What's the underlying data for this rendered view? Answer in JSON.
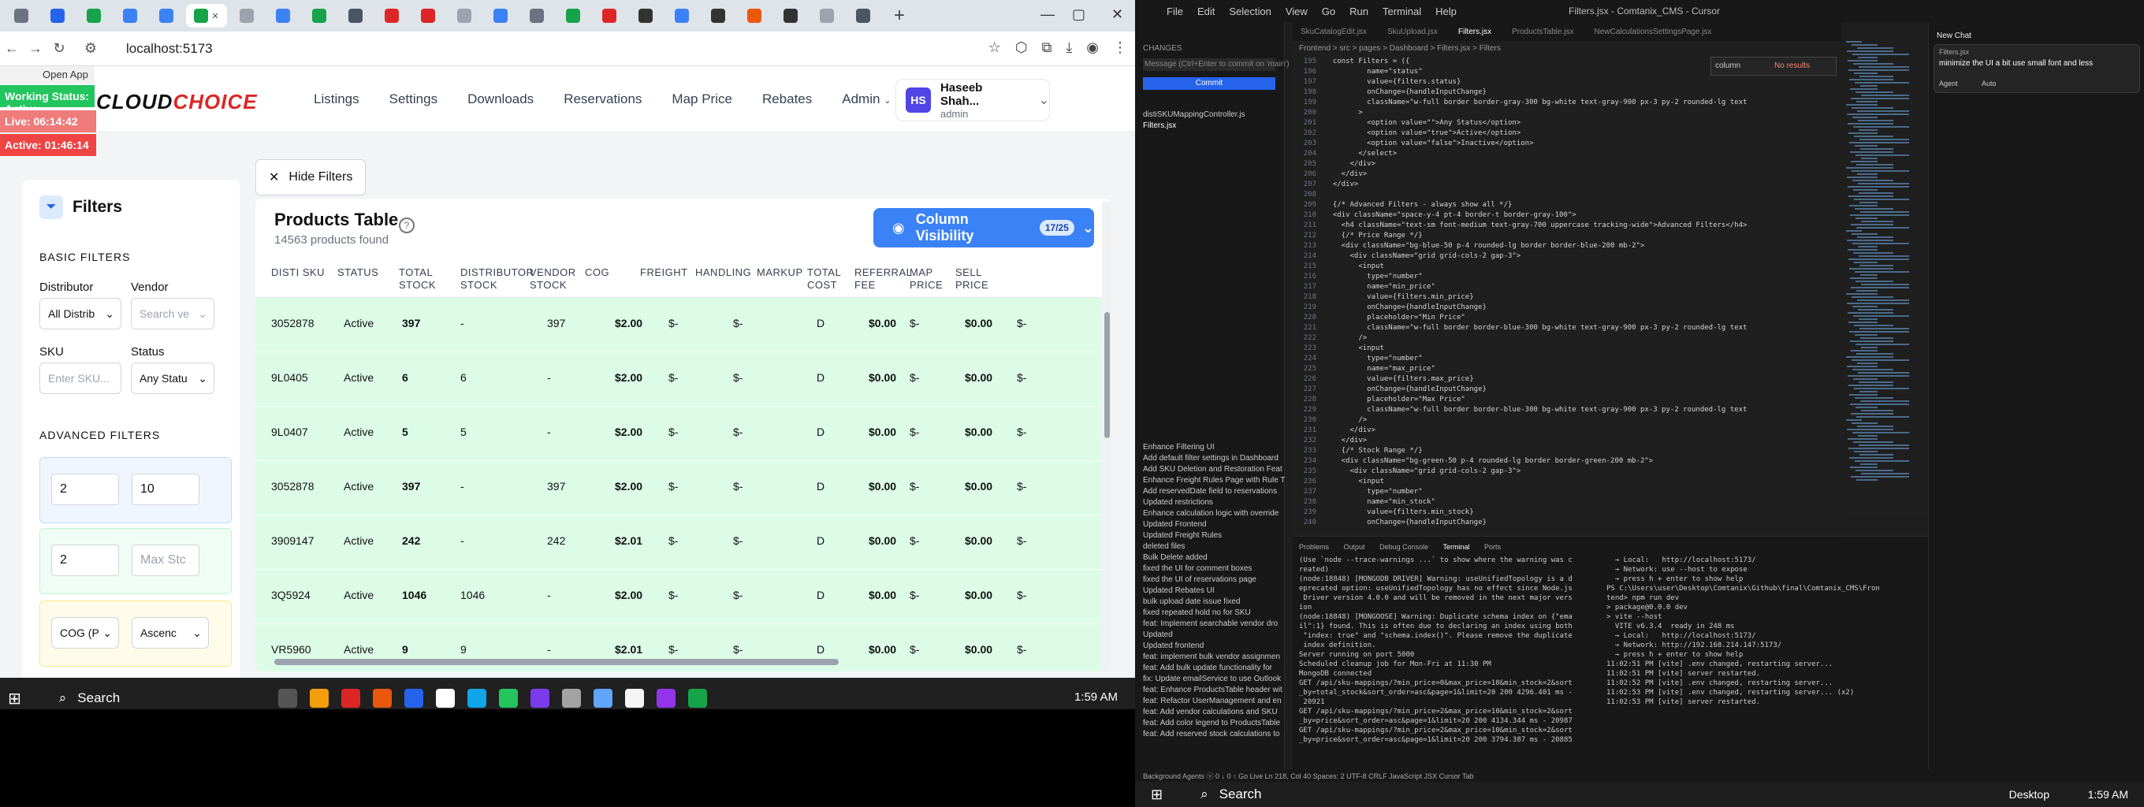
{
  "browser": {
    "url": "localhost:5173",
    "favicons": [
      "#6b7280",
      "#2563eb",
      "#16a34a",
      "#3b82f6",
      "#3b82f6",
      "#16a34a",
      "#9ca3af",
      "#3b82f6",
      "#16a34a",
      "#4b5563",
      "#dc2626",
      "#dc2626",
      "#9ca3af",
      "#3b82f6",
      "#6b7280",
      "#16a34a",
      "#dc2626",
      "#333333",
      "#3b82f6",
      "#333333",
      "#ea580c",
      "#333333",
      "#9ca3af",
      "#4b5563"
    ]
  },
  "overlay": {
    "open_app": "Open App",
    "working_status": "Working Status: Active",
    "live": "Live: 06:14:42",
    "active": "Active: 01:46:14"
  },
  "app": {
    "logo_main": "CLOUD",
    "logo_accent": "CHOICE",
    "nav": [
      "Listings",
      "Settings",
      "Downloads",
      "Reservations",
      "Map Price",
      "Rebates",
      "Admin"
    ],
    "user_name": "Haseeb Shah...",
    "user_role": "admin",
    "user_initials": "HS",
    "hide_filters": "Hide Filters"
  },
  "filters": {
    "title": "Filters",
    "basic": "BASIC FILTERS",
    "distributor_label": "Distributor",
    "distributor_value": "All Distrib",
    "vendor_label": "Vendor",
    "vendor_placeholder": "Search ve",
    "sku_label": "SKU",
    "sku_placeholder": "Enter SKU...",
    "status_label": "Status",
    "status_value": "Any Statu",
    "advanced": "ADVANCED FILTERS",
    "price_min": "2",
    "price_max": "10",
    "stock_min": "2",
    "stock_max_placeholder": "Max Stc",
    "sort_field": "COG (P",
    "sort_order": "Ascenc"
  },
  "products": {
    "title": "Products Table",
    "subtitle": "14563 products found",
    "col_visibility": "Column Visibility",
    "col_count": "17/25",
    "columns": [
      "DISTI SKU",
      "STATUS",
      "TOTAL STOCK",
      "DISTRIBUTOR STOCK",
      "VENDOR STOCK",
      "COG",
      "FREIGHT",
      "HANDLING",
      "MARKUP",
      "TOTAL COST",
      "REFERRAL FEE",
      "MAP PRICE",
      "SELL PRICE"
    ],
    "rows": [
      [
        "3052878",
        "Active",
        "397",
        "-",
        "397",
        "$2.00",
        "$-",
        "$-",
        "D",
        "$0.00",
        "$-",
        "$-",
        "$0.00",
        "$-"
      ],
      [
        "9L0405",
        "Active",
        "6",
        "6",
        "-",
        "$2.00",
        "$-",
        "$-",
        "D",
        "$0.00",
        "$-",
        "$-",
        "$0.00",
        "$-"
      ],
      [
        "9L0407",
        "Active",
        "5",
        "5",
        "-",
        "$2.00",
        "$-",
        "$-",
        "D",
        "$0.00",
        "$-",
        "$-",
        "$0.00",
        "$-"
      ],
      [
        "3052878",
        "Active",
        "397",
        "-",
        "397",
        "$2.00",
        "$-",
        "$-",
        "D",
        "$0.00",
        "$-",
        "$-",
        "$0.00",
        "$-"
      ],
      [
        "3909147",
        "Active",
        "242",
        "-",
        "242",
        "$2.01",
        "$-",
        "$-",
        "D",
        "$0.00",
        "$-",
        "$-",
        "$0.00",
        "$-"
      ],
      [
        "3Q5924",
        "Active",
        "1046",
        "1046",
        "-",
        "$2.00",
        "$-",
        "$-",
        "D",
        "$0.00",
        "$-",
        "$-",
        "$0.00",
        "$-"
      ],
      [
        "VR5960",
        "Active",
        "9",
        "9",
        "-",
        "$2.01",
        "$-",
        "$-",
        "D",
        "$0.00",
        "$-",
        "$-",
        "$0.00",
        "$-"
      ]
    ]
  },
  "taskbar": {
    "search": "Search",
    "time_left": "1:59 AM",
    "time_right": "1:59 AM",
    "desktop": "Desktop"
  },
  "editor": {
    "menu": [
      "File",
      "Edit",
      "Selection",
      "View",
      "Go",
      "Run",
      "Terminal",
      "Help"
    ],
    "window_title": "Filters.jsx - Comtanix_CMS - Cursor",
    "tabs": [
      "SkuCatalogEdit.jsx",
      "SkuUpload.jsx",
      "Filters.jsx",
      "ProductsTable.jsx",
      "NewCalculationsSettingsPage.jsx"
    ],
    "breadcrumb": "Frontend > src > pages > Dashboard > Filters.jsx > Filters",
    "find_value": "column",
    "find_result": "No results",
    "code": [
      {
        "n": "195",
        "t": "  const Filters = ({"
      },
      {
        "n": "196",
        "t": "          name=\"status\""
      },
      {
        "n": "197",
        "t": "          value={filters.status}"
      },
      {
        "n": "198",
        "t": "          onChange={handleInputChange}"
      },
      {
        "n": "199",
        "t": "          className=\"w-full border border-gray-300 bg-white text-gray-900 px-3 py-2 rounded-lg text"
      },
      {
        "n": "200",
        "t": "        >"
      },
      {
        "n": "201",
        "t": "          <option value=\"\">Any Status</option>"
      },
      {
        "n": "202",
        "t": "          <option value=\"true\">Active</option>"
      },
      {
        "n": "203",
        "t": "          <option value=\"false\">Inactive</option>"
      },
      {
        "n": "204",
        "t": "        </select>"
      },
      {
        "n": "205",
        "t": "      </div>"
      },
      {
        "n": "206",
        "t": "    </div>"
      },
      {
        "n": "207",
        "t": "  </div>"
      },
      {
        "n": "208",
        "t": ""
      },
      {
        "n": "209",
        "t": "  {/* Advanced Filters - always show all */}"
      },
      {
        "n": "210",
        "t": "  <div className=\"space-y-4 pt-4 border-t border-gray-100\">"
      },
      {
        "n": "211",
        "t": "    <h4 className=\"text-sm font-medium text-gray-700 uppercase tracking-wide\">Advanced Filters</h4>"
      },
      {
        "n": "212",
        "t": "    {/* Price Range */}"
      },
      {
        "n": "213",
        "t": "    <div className=\"bg-blue-50 p-4 rounded-lg border border-blue-200 mb-2\">"
      },
      {
        "n": "214",
        "t": "      <div className=\"grid grid-cols-2 gap-3\">"
      },
      {
        "n": "215",
        "t": "        <input"
      },
      {
        "n": "216",
        "t": "          type=\"number\""
      },
      {
        "n": "217",
        "t": "          name=\"min_price\""
      },
      {
        "n": "218",
        "t": "          value={filters.min_price}"
      },
      {
        "n": "219",
        "t": "          onChange={handleInputChange}"
      },
      {
        "n": "220",
        "t": "          placeholder=\"Min Price\""
      },
      {
        "n": "221",
        "t": "          className=\"w-full border border-blue-300 bg-white text-gray-900 px-3 py-2 rounded-lg text"
      },
      {
        "n": "222",
        "t": "        />"
      },
      {
        "n": "223",
        "t": "        <input"
      },
      {
        "n": "224",
        "t": "          type=\"number\""
      },
      {
        "n": "225",
        "t": "          name=\"max_price\""
      },
      {
        "n": "226",
        "t": "          value={filters.max_price}"
      },
      {
        "n": "227",
        "t": "          onChange={handleInputChange}"
      },
      {
        "n": "228",
        "t": "          placeholder=\"Max Price\""
      },
      {
        "n": "229",
        "t": "          className=\"w-full border border-blue-300 bg-white text-gray-900 px-3 py-2 rounded-lg text"
      },
      {
        "n": "230",
        "t": "        />"
      },
      {
        "n": "231",
        "t": "      </div>"
      },
      {
        "n": "232",
        "t": "    </div>"
      },
      {
        "n": "233",
        "t": "    {/* Stock Range */}"
      },
      {
        "n": "234",
        "t": "    <div className=\"bg-green-50 p-4 rounded-lg border border-green-200 mb-2\">"
      },
      {
        "n": "235",
        "t": "      <div className=\"grid grid-cols-2 gap-3\">"
      },
      {
        "n": "236",
        "t": "        <input"
      },
      {
        "n": "237",
        "t": "          type=\"number\""
      },
      {
        "n": "238",
        "t": "          name=\"min_stock\""
      },
      {
        "n": "239",
        "t": "          value={filters.min_stock}"
      },
      {
        "n": "240",
        "t": "          onChange={handleInputChange}"
      }
    ],
    "chat_title": "New Chat",
    "chat_file": "Filters.jsx",
    "chat_text": "minimize the UI a bit use small font and less",
    "chat_mode": "Agent",
    "chat_model": "Auto",
    "scm_header": "CHANGES",
    "scm_message": "Message (Ctrl+Enter to commit on 'main')",
    "scm_commit": "Commit",
    "scm_files": [
      "distiSKUMappingController.js",
      "Filters.jsx"
    ],
    "graph_items": [
      "Enhance Filtering UI",
      "Add default filter settings in Dashboard",
      "Add SKU Deletion and Restoration Feat",
      "Enhance Freight Rules Page with Rule T",
      "Add reservedDate field to reservations",
      "Updated restrictions",
      "Enhance calculation logic with override",
      "Updated Frontend",
      "Updated Freight Rules",
      "deleted files",
      "Bulk Delete added",
      "fixed the UI for comment boxes",
      "fixed the UI of reservations page",
      "Updated Rebates UI",
      "bulk upload date issue fixed",
      "fixed repeated hold no for SKU",
      "feat: Implement searchable vendor dro",
      "Updated",
      "Updated frontend",
      "feat: implement bulk vendor assignmen",
      "feat: Add bulk update functionality for",
      "fix: Update emailService to use Outlook",
      "feat: Enhance ProductsTable header wit",
      "feat: Refactor UserManagement and en",
      "feat: Add vendor calculations and SKU",
      "feat: Add color legend to ProductsTable",
      "feat: Add reserved stock calculations to"
    ],
    "terminal_tabs": [
      "Problems",
      "Output",
      "Debug Console",
      "Terminal",
      "Ports"
    ],
    "terminal_left": [
      "(Use `node --trace-warnings ...` to show where the warning was c",
      "reated)",
      "(node:18848) [MONGODB DRIVER] Warning: useUnifiedTopology is a d",
      "eprecated option: useUnifiedTopology has no effect since Node.js",
      " Driver version 4.0.0 and will be removed in the next major vers",
      "ion",
      "(node:18848) [MONGOOSE] Warning: Duplicate schema index on {\"ema",
      "il\":1} found. This is often due to declaring an index using both",
      " \"index: true\" and \"schema.index()\". Please remove the duplicate",
      " index definition.",
      "Server running on port 5000",
      "Scheduled cleanup job for Mon-Fri at 11:30 PM",
      "MongoDB connected",
      "GET /api/sku-mappings/?min_price=0&max_price=10&min_stock=2&sort",
      "_by=total_stock&sort_order=asc&page=1&limit=20 200 4296.401 ms -",
      " 20921",
      "GET /api/sku-mappings/?min_price=2&max_price=10&min_stock=2&sort",
      "_by=price&sort_order=asc&page=1&limit=20 200 4134.344 ms - 20987",
      "GET /api/sku-mappings/?min_price=2&max_price=10&min_stock=2&sort",
      "_by=price&sort_order=asc&page=1&limit=20 200 3794.387 ms - 20885"
    ],
    "terminal_right": [
      "  → Local:   http://localhost:5173/",
      "  → Network: use --host to expose",
      "  → press h + enter to show help",
      "PS C:\\Users\\user\\Desktop\\Comtanix\\Github\\final\\Comtanix_CMS\\Fron",
      "tend> npm run dev",
      "",
      "> package@0.0.0 dev",
      "> vite --host",
      "",
      "",
      "  VITE v6.3.4  ready in 248 ms",
      "",
      "  → Local:   http://localhost:5173/",
      "  → Network: http://192.168.214.147:5173/",
      "  → press h + enter to show help",
      "11:02:51 PM [vite] .env changed, restarting server...",
      "11:02:51 PM [vite] server restarted.",
      "11:02:52 PM [vite] .env changed, restarting server...",
      "11:02:53 PM [vite] .env changed, restarting server... (x2)",
      "11:02:53 PM [vite] server restarted."
    ],
    "statusbar": "Background Agents   ⓥ 0 ↓ 0 ↑   Go Live   Ln 218, Col 40   Spaces: 2   UTF-8   CRLF   JavaScript JSX   Cursor Tab"
  }
}
